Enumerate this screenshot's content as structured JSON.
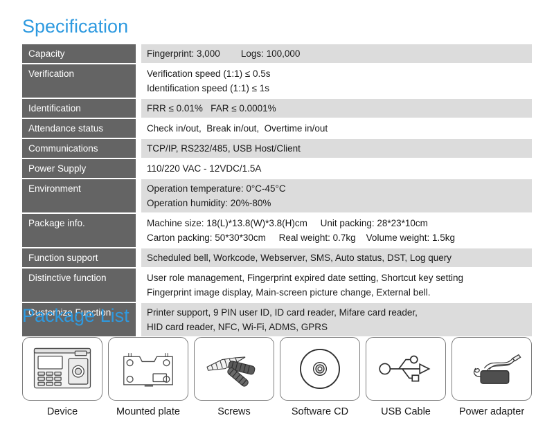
{
  "spec": {
    "title": "Specification",
    "rows": [
      {
        "label": "Capacity",
        "shaded": true,
        "lines": [
          "Fingerprint: 3,000        Logs: 100,000"
        ]
      },
      {
        "label": "Verification",
        "shaded": false,
        "lines": [
          "Verification speed (1:1) ≤ 0.5s",
          "Identification speed (1:1) ≤ 1s"
        ]
      },
      {
        "label": "Identification",
        "shaded": true,
        "lines": [
          "FRR ≤ 0.01%   FAR ≤ 0.0001%"
        ]
      },
      {
        "label": "Attendance status",
        "shaded": false,
        "lines": [
          "Check in/out,  Break in/out,  Overtime in/out"
        ]
      },
      {
        "label": "Communications",
        "shaded": true,
        "lines": [
          "TCP/IP, RS232/485, USB Host/Client"
        ]
      },
      {
        "label": "Power Supply",
        "shaded": false,
        "lines": [
          "110/220 VAC - 12VDC/1.5A"
        ]
      },
      {
        "label": "Environment",
        "shaded": true,
        "lines": [
          "Operation temperature: 0°C-45°C",
          "Operation humidity: 20%-80%"
        ]
      },
      {
        "label": "Package info.",
        "shaded": false,
        "lines": [
          "Machine size: 18(L)*13.8(W)*3.8(H)cm     Unit packing: 28*23*10cm",
          "Carton packing: 50*30*30cm     Real weight: 0.7kg    Volume weight: 1.5kg"
        ]
      },
      {
        "label": "Function support",
        "shaded": true,
        "lines": [
          "Scheduled bell, Workcode, Webserver, SMS, Auto status, DST, Log query"
        ]
      },
      {
        "label": "Distinctive function",
        "shaded": false,
        "lines": [
          "User role management, Fingerprint expired date setting, Shortcut key setting",
          "Fingerprint image display, Main-screen picture change, External bell."
        ]
      },
      {
        "label": "Customize Function",
        "shaded": true,
        "lines": [
          "Printer support, 9 PIN user ID, ID card reader, Mifare card reader,",
          "HID card reader, NFC, Wi-Fi, ADMS, GPRS"
        ]
      }
    ]
  },
  "package": {
    "title": "Package List",
    "items": [
      {
        "caption": "Device",
        "icon": "fingerprint-terminal-icon"
      },
      {
        "caption": "Mounted plate",
        "icon": "mounting-plate-icon"
      },
      {
        "caption": "Screws",
        "icon": "screws-icon"
      },
      {
        "caption": "Software CD",
        "icon": "cd-disc-icon"
      },
      {
        "caption": "USB Cable",
        "icon": "usb-icon"
      },
      {
        "caption": "Power adapter",
        "icon": "power-adapter-icon"
      }
    ]
  },
  "colors": {
    "heading_blue": "#2e9ae0",
    "label_gray": "#646464",
    "row_shade": "#dcdcdc",
    "box_border": "#7d7d7d"
  }
}
